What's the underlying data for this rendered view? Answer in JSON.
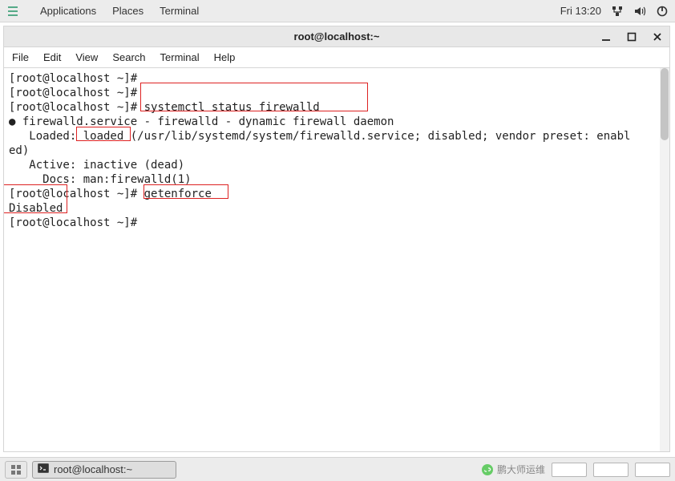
{
  "top_panel": {
    "applications": "Applications",
    "places": "Places",
    "terminal_menu": "Terminal",
    "clock": "Fri 13:20"
  },
  "window": {
    "title": "root@localhost:~",
    "menu": {
      "file": "File",
      "edit": "Edit",
      "view": "View",
      "search": "Search",
      "terminal": "Terminal",
      "help": "Help"
    }
  },
  "terminal": {
    "prompt": "[root@localhost ~]#",
    "cmd1": "systemctl status firewalld",
    "out1_line1_a": "● firewalld.service - firewalld - dynamic firewall daemon",
    "out1_line2_prefix": "   Loaded: ",
    "out1_line2_loaded": "loaded",
    "out1_line2_rest": " (/usr/lib/systemd/system/firewalld.service; disabled; vendor preset: enabl",
    "out1_line3": "ed)",
    "out1_line4": "   Active: inactive (dead)",
    "out1_line5": "     Docs: man:firewalld(1)",
    "cmd2": "getenforce",
    "out2": "Disabled"
  },
  "taskbar": {
    "task_title": "root@localhost:~"
  },
  "branding": {
    "text": "鹏大师运维"
  }
}
